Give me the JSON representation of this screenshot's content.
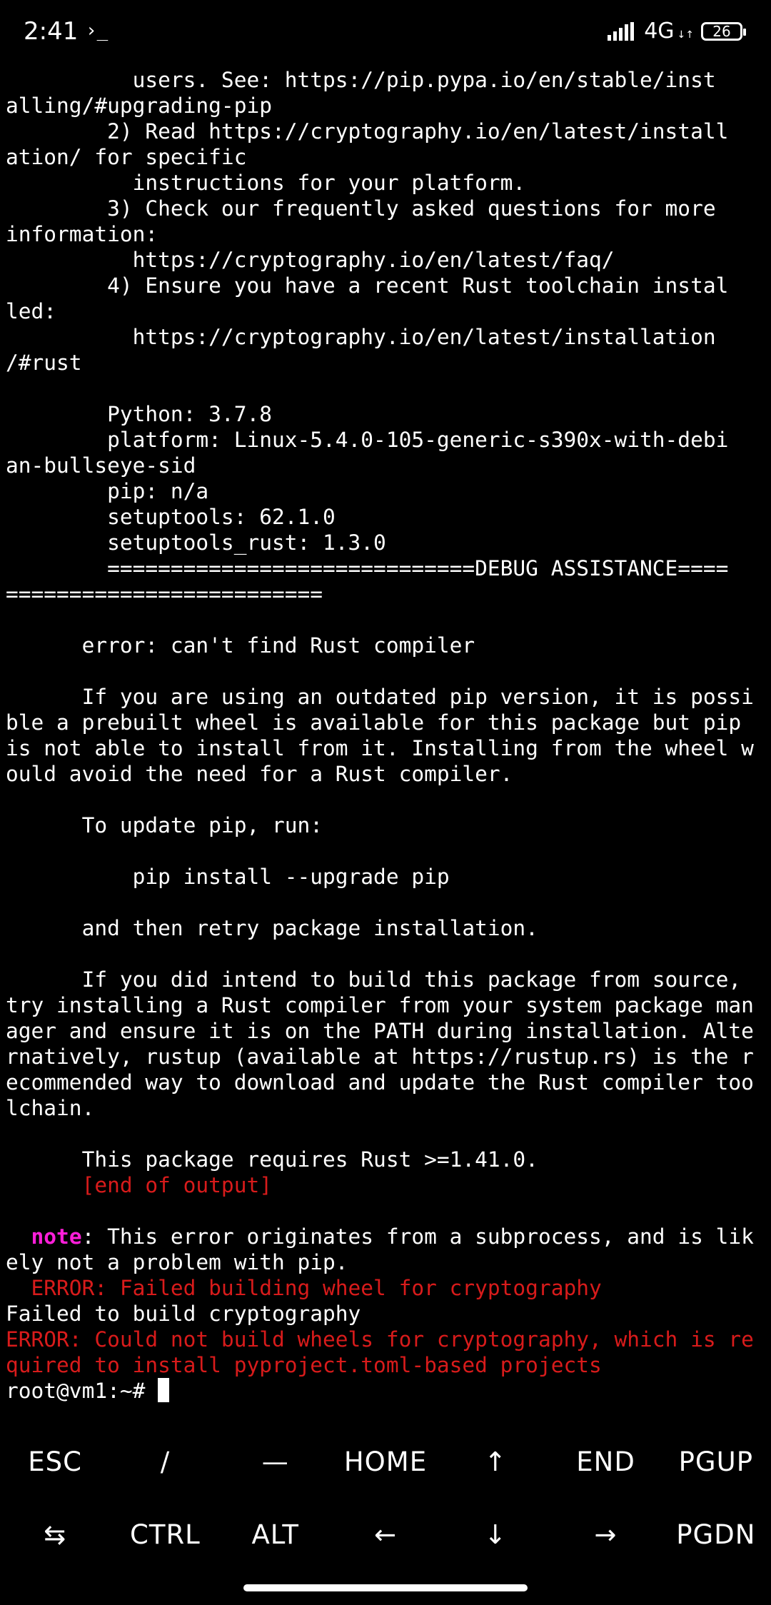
{
  "status_bar": {
    "time": "2:41",
    "terminal_icon": "›_",
    "network": "4G",
    "network_arrows": "↓↑",
    "battery": "26"
  },
  "terminal": {
    "lines": [
      {
        "text": "          users. See: https://pip.pypa.io/en/stable/inst",
        "color": "default"
      },
      {
        "text": "alling/#upgrading-pip",
        "color": "default"
      },
      {
        "text": "        2) Read https://cryptography.io/en/latest/install",
        "color": "default"
      },
      {
        "text": "ation/ for specific",
        "color": "default"
      },
      {
        "text": "          instructions for your platform.",
        "color": "default"
      },
      {
        "text": "        3) Check our frequently asked questions for more",
        "color": "default"
      },
      {
        "text": "information:",
        "color": "default"
      },
      {
        "text": "          https://cryptography.io/en/latest/faq/",
        "color": "default"
      },
      {
        "text": "        4) Ensure you have a recent Rust toolchain instal",
        "color": "default"
      },
      {
        "text": "led:",
        "color": "default"
      },
      {
        "text": "          https://cryptography.io/en/latest/installation",
        "color": "default"
      },
      {
        "text": "/#rust",
        "color": "default"
      },
      {
        "text": "",
        "color": "default"
      },
      {
        "text": "        Python: 3.7.8",
        "color": "default"
      },
      {
        "text": "        platform: Linux-5.4.0-105-generic-s390x-with-debi",
        "color": "default"
      },
      {
        "text": "an-bullseye-sid",
        "color": "default"
      },
      {
        "text": "        pip: n/a",
        "color": "default"
      },
      {
        "text": "        setuptools: 62.1.0",
        "color": "default"
      },
      {
        "text": "        setuptools_rust: 1.3.0",
        "color": "default"
      },
      {
        "text": "        =============================DEBUG ASSISTANCE====",
        "color": "default"
      },
      {
        "text": "=========================",
        "color": "default"
      },
      {
        "text": "",
        "color": "default"
      },
      {
        "text": "      error: can't find Rust compiler",
        "color": "default"
      },
      {
        "text": "",
        "color": "default"
      },
      {
        "text": "      If you are using an outdated pip version, it is possi",
        "color": "default"
      },
      {
        "text": "ble a prebuilt wheel is available for this package but pip",
        "color": "default"
      },
      {
        "text": "is not able to install from it. Installing from the wheel w",
        "color": "default"
      },
      {
        "text": "ould avoid the need for a Rust compiler.",
        "color": "default"
      },
      {
        "text": "",
        "color": "default"
      },
      {
        "text": "      To update pip, run:",
        "color": "default"
      },
      {
        "text": "",
        "color": "default"
      },
      {
        "text": "          pip install --upgrade pip",
        "color": "default"
      },
      {
        "text": "",
        "color": "default"
      },
      {
        "text": "      and then retry package installation.",
        "color": "default"
      },
      {
        "text": "",
        "color": "default"
      },
      {
        "text": "      If you did intend to build this package from source,",
        "color": "default"
      },
      {
        "text": "try installing a Rust compiler from your system package man",
        "color": "default"
      },
      {
        "text": "ager and ensure it is on the PATH during installation. Alte",
        "color": "default"
      },
      {
        "text": "rnatively, rustup (available at https://rustup.rs) is the r",
        "color": "default"
      },
      {
        "text": "ecommended way to download and update the Rust compiler too",
        "color": "default"
      },
      {
        "text": "lchain.",
        "color": "default"
      },
      {
        "text": "",
        "color": "default"
      },
      {
        "text": "      This package requires Rust >=1.41.0.",
        "color": "default"
      },
      {
        "text": "      [end of output]",
        "color": "red"
      },
      {
        "text": "",
        "color": "default"
      },
      {
        "segments": [
          {
            "text": "  ",
            "color": "default"
          },
          {
            "text": "note",
            "color": "magenta"
          },
          {
            "text": ": This error originates from a subprocess, and is lik",
            "color": "default"
          }
        ]
      },
      {
        "text": "ely not a problem with pip.",
        "color": "default"
      },
      {
        "text": "  ERROR: Failed building wheel for cryptography",
        "color": "red"
      },
      {
        "text": "Failed to build cryptography",
        "color": "default"
      },
      {
        "text": "ERROR: Could not build wheels for cryptography, which is re",
        "color": "red"
      },
      {
        "text": "quired to install pyproject.toml-based projects",
        "color": "red"
      }
    ],
    "prompt": "root@vm1:~# "
  },
  "extra_keys": {
    "row1": [
      "ESC",
      "/",
      "—",
      "HOME",
      "↑",
      "END",
      "PGUP"
    ],
    "row2": [
      "⇆",
      "CTRL",
      "ALT",
      "←",
      "↓",
      "→",
      "PGDN"
    ]
  },
  "colors": {
    "background": "#000000",
    "text": "#ffffff",
    "error_red": "#d81b1b",
    "note_magenta": "#ff1ed9"
  }
}
